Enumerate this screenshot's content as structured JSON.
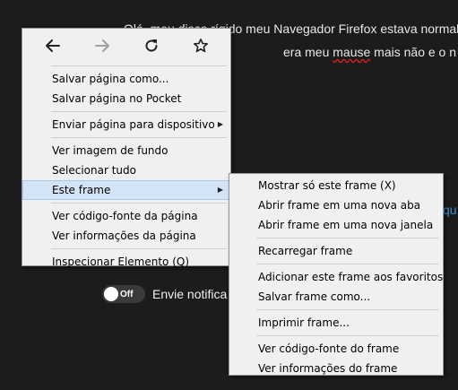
{
  "background": {
    "line1": "Olá, meu disco rígido meu Navegador Firefox estava normal co",
    "line2_before": "era meu ",
    "line2_misspelled": "mause",
    "line2_after": " mais não e o n",
    "link_fragment": "qu",
    "toggle_state": "Off",
    "toggle_label": "Envie notifica"
  },
  "nav": {
    "back": "arrow-left-icon",
    "forward": "arrow-right-icon",
    "reload": "reload-icon",
    "bookmark": "star-icon"
  },
  "main_menu": {
    "save_page": "Salvar página como...",
    "save_pocket": "Salvar página no Pocket",
    "send_device": "Enviar página para dispositivo",
    "view_bg_image": "Ver imagem de fundo",
    "select_all": "Selecionar tudo",
    "this_frame": "Este frame",
    "view_source": "Ver código-fonte da página",
    "view_info": "Ver informações da página",
    "inspect": "Inspecionar Elemento (Q)"
  },
  "sub_menu": {
    "show_only": "Mostrar só este frame (X)",
    "open_tab": "Abrir frame em uma nova aba",
    "open_window": "Abrir frame em uma nova janela",
    "reload": "Recarregar frame",
    "bookmark": "Adicionar este frame aos favoritos",
    "save": "Salvar frame como...",
    "print": "Imprimir frame...",
    "view_source": "Ver código-fonte do frame",
    "view_info": "Ver informações do frame"
  }
}
